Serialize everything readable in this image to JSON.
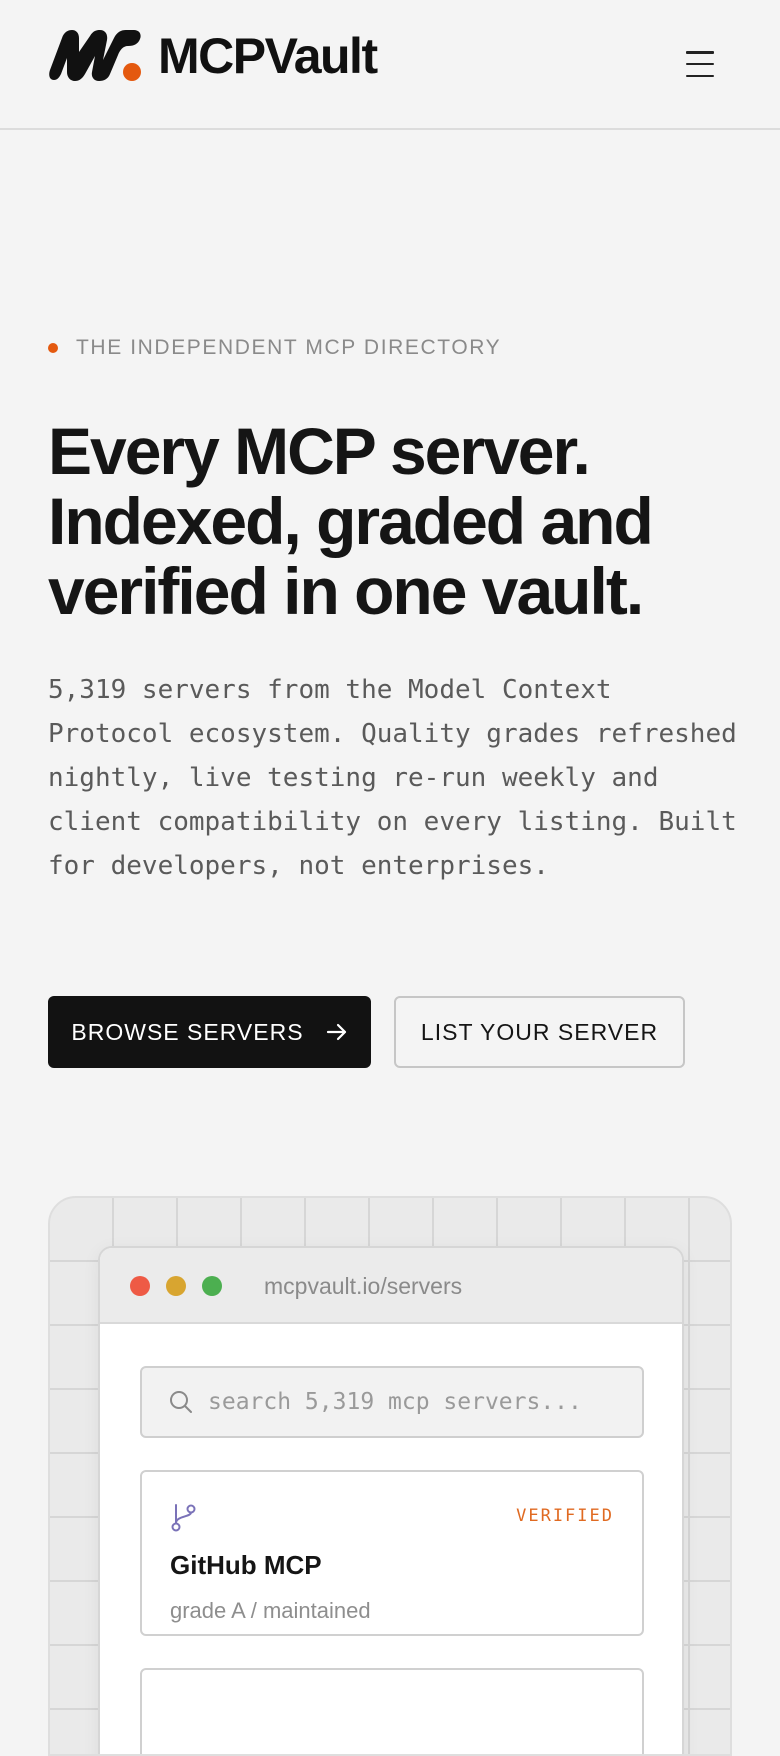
{
  "brand": {
    "name": "MCPVault",
    "accent": "#e4590f"
  },
  "header": {
    "menu_icon": "hamburger-menu-icon"
  },
  "hero": {
    "eyebrow": "THE INDEPENDENT MCP DIRECTORY",
    "headline_lines": [
      "Every MCP server.",
      "Indexed, graded and",
      "verified in one vault."
    ],
    "description": "5,319 servers from the Model Context Protocol ecosystem. Quality grades refreshed nightly, live testing re-run weekly and client compatibility on every listing. Built for developers, not enterprises.",
    "primary_cta": "BROWSE SERVERS",
    "secondary_cta": "LIST YOUR SERVER"
  },
  "preview": {
    "url": "mcpvault.io/servers",
    "search_placeholder": "search 5,319 mcp servers...",
    "servers": [
      {
        "icon": "git-branch-icon",
        "badge": "VERIFIED",
        "name": "GitHub MCP",
        "meta": "grade A / maintained"
      }
    ]
  }
}
